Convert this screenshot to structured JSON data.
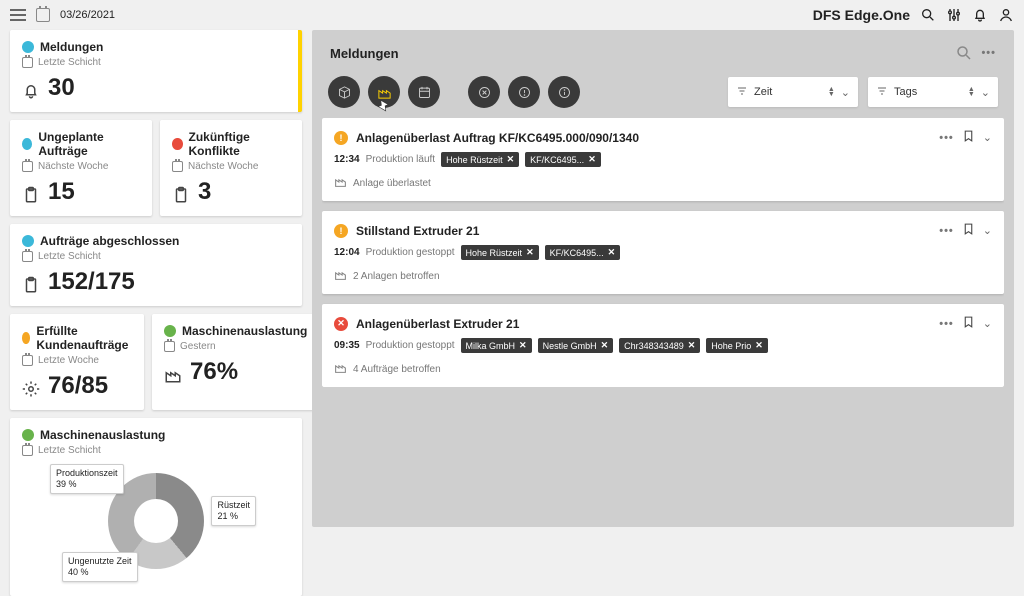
{
  "header": {
    "date": "03/26/2021",
    "brand_bold1": "DFS",
    "brand_bold2": "Edge.One"
  },
  "sidebar": {
    "meldungen": {
      "title": "Meldungen",
      "sub": "Letzte Schicht",
      "value": "30"
    },
    "ungeplante": {
      "title": "Ungeplante Aufträge",
      "sub": "Nächste Woche",
      "value": "15"
    },
    "konflikte": {
      "title": "Zukünftige Konflikte",
      "sub": "Nächste Woche",
      "value": "3"
    },
    "abgeschlossen": {
      "title": "Aufträge abgeschlossen",
      "sub": "Letzte Schicht",
      "value": "152/175"
    },
    "erfuellte": {
      "title": "Erfüllte Kundenaufträge",
      "sub": "Letzte Woche",
      "value": "76/85"
    },
    "maschinen1": {
      "title": "Maschinenauslastung",
      "sub": "Gestern",
      "value": "76%"
    },
    "maschinen2": {
      "title": "Maschinenauslastung",
      "sub": "Letzte Schicht"
    }
  },
  "chart_data": {
    "type": "pie",
    "title": "Maschinenauslastung",
    "series": [
      {
        "name": "Produktionszeit",
        "value": 39
      },
      {
        "name": "Rüstzeit",
        "value": 21
      },
      {
        "name": "Ungenutzte Zeit",
        "value": 40
      }
    ],
    "labels": {
      "prod": "Produktionszeit",
      "prod_pct": "39 %",
      "ruest": "Rüstzeit",
      "ruest_pct": "21 %",
      "ungen": "Ungenutzte Zeit",
      "ungen_pct": "40 %"
    }
  },
  "panel": {
    "title": "Meldungen",
    "filter_time": "Zeit",
    "filter_tags": "Tags"
  },
  "messages": [
    {
      "status": "orange",
      "excl": "!",
      "title": "Anlagenüberlast Auftrag KF/KC6495.000/090/1340",
      "time": "12:34",
      "state": "Produktion läuft",
      "tags": [
        "Hohe Rüstzeit",
        "KF/KC6495..."
      ],
      "foot": "Anlage überlastet"
    },
    {
      "status": "orange",
      "excl": "!",
      "title": "Stillstand Extruder 21",
      "time": "12:04",
      "state": "Produktion gestoppt",
      "tags": [
        "Hohe Rüstzeit",
        "KF/KC6495..."
      ],
      "foot": "2 Anlagen betroffen"
    },
    {
      "status": "red",
      "excl": "✕",
      "title": "Anlagenüberlast Extruder 21",
      "time": "09:35",
      "state": "Produktion gestoppt",
      "tags": [
        "Milka GmbH",
        "Nestle GmbH",
        "Chr348343489",
        "Hohe Prio"
      ],
      "foot": "4 Aufträge betroffen"
    }
  ]
}
